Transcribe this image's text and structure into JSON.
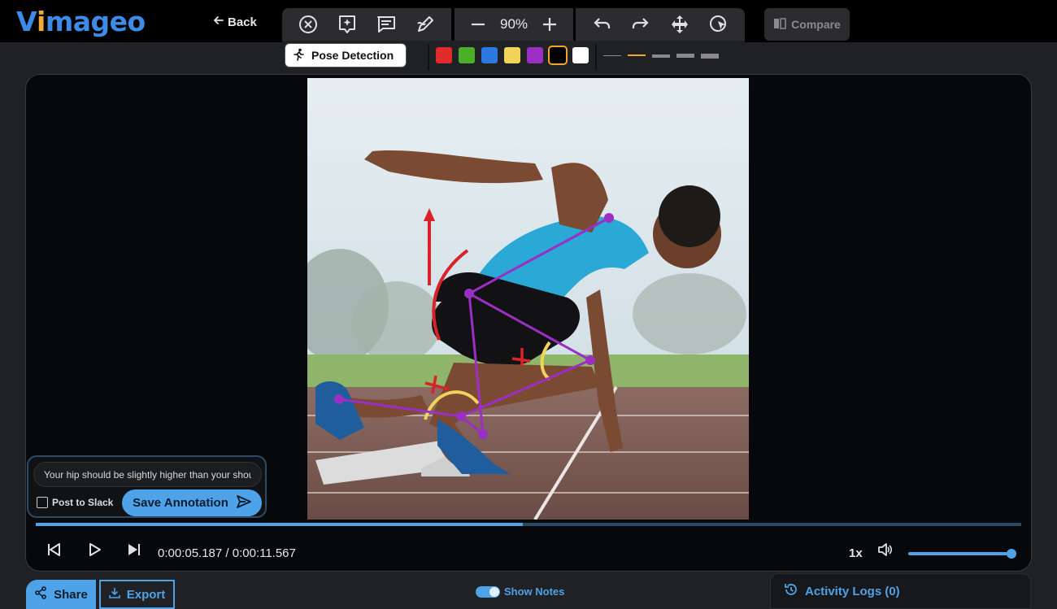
{
  "app": {
    "logo": {
      "v": "V",
      "i": "i",
      "rest": "mageo"
    },
    "back_label": "Back",
    "compare_label": "Compare"
  },
  "toolbar": {
    "zoom": "90%",
    "pose_detection_label": "Pose Detection",
    "colors": [
      "#e02b2b",
      "#4caf2a",
      "#2b79e0",
      "#f2d35a",
      "#9b2fc4",
      "#000000",
      "#ffffff"
    ],
    "selected_color_index": 5,
    "stroke_widths": [
      1,
      2,
      3,
      4,
      5
    ],
    "selected_stroke_index": 1
  },
  "player": {
    "time_current": "0:00:05.187",
    "time_total": "0:00:11.567",
    "time_display": "0:00:05.187 / 0:00:11.567",
    "progress_fraction": 0.494,
    "speed": "1x",
    "volume_fraction": 1.0
  },
  "annotation": {
    "text": "Your hip should be slightly higher than your shoulders",
    "post_to_slack_label": "Post to Slack",
    "post_to_slack_checked": false,
    "save_label": "Save Annotation"
  },
  "bottom": {
    "share_label": "Share",
    "export_label": "Export",
    "show_notes_label": "Show Notes",
    "show_notes_on": true,
    "activity_logs_label": "Activity Logs (0)"
  },
  "colors": {
    "accent": "#4ea3e8",
    "pose_skeleton": "#9b2fc4",
    "annotation_red": "#d8232a",
    "annotation_yellow": "#f2d35a"
  }
}
